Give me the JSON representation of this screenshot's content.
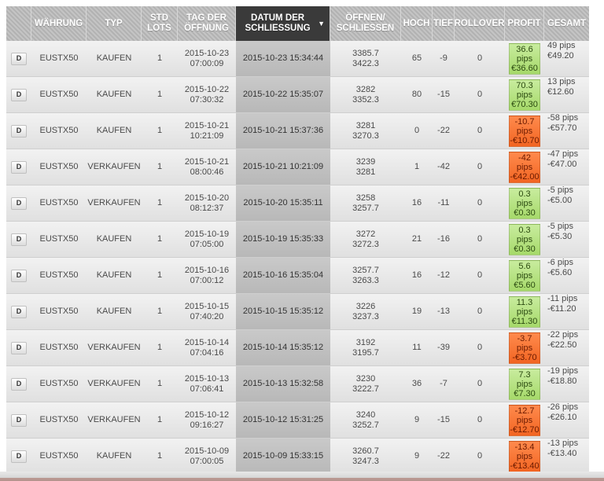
{
  "headers": {
    "d": "",
    "currency": "WÄHRUNG",
    "type": "TYP",
    "lots": "STD LOTS",
    "open_date": "TAG DER ÖFFNUNG",
    "close_date": "DATUM DER SCHLIESSUNG",
    "open_close": "ÖFFNEN/ SCHLIESSEN",
    "high": "HOCH",
    "low": "TIEF",
    "rollover": "ROLLOVER",
    "profit": "PROFIT",
    "total": "GESAMT"
  },
  "sort_arrow": "▼",
  "colors": {
    "win": "#a6d96a",
    "loss": "#f26522",
    "sorted_header": "#3a3a3a"
  },
  "rows": [
    {
      "d": "D",
      "currency": "EUSTX50",
      "type": "KAUFEN",
      "lots": "1",
      "open_date": "2015-10-23",
      "open_time": "07:00:09",
      "close": "2015-10-23 15:34:44",
      "open_px": "3385.7",
      "close_px": "3422.3",
      "high": "65",
      "low": "-9",
      "rollover": "0",
      "profit_pips": "36.6",
      "profit_unit": "pips",
      "profit_eur": "€36.60",
      "result": "win",
      "total_pips": "49 pips",
      "total_eur": "€49.20"
    },
    {
      "d": "D",
      "currency": "EUSTX50",
      "type": "KAUFEN",
      "lots": "1",
      "open_date": "2015-10-22",
      "open_time": "07:30:32",
      "close": "2015-10-22 15:35:07",
      "open_px": "3282",
      "close_px": "3352.3",
      "high": "80",
      "low": "-15",
      "rollover": "0",
      "profit_pips": "70.3",
      "profit_unit": "pips",
      "profit_eur": "€70.30",
      "result": "win",
      "total_pips": "13 pips",
      "total_eur": "€12.60"
    },
    {
      "d": "D",
      "currency": "EUSTX50",
      "type": "KAUFEN",
      "lots": "1",
      "open_date": "2015-10-21",
      "open_time": "10:21:09",
      "close": "2015-10-21 15:37:36",
      "open_px": "3281",
      "close_px": "3270.3",
      "high": "0",
      "low": "-22",
      "rollover": "0",
      "profit_pips": "-10.7",
      "profit_unit": "pips",
      "profit_eur": "-€10.70",
      "result": "loss",
      "total_pips": "-58 pips",
      "total_eur": "-€57.70"
    },
    {
      "d": "D",
      "currency": "EUSTX50",
      "type": "VERKAUFEN",
      "lots": "1",
      "open_date": "2015-10-21",
      "open_time": "08:00:46",
      "close": "2015-10-21 10:21:09",
      "open_px": "3239",
      "close_px": "3281",
      "high": "1",
      "low": "-42",
      "rollover": "0",
      "profit_pips": "-42",
      "profit_unit": "pips",
      "profit_eur": "-€42.00",
      "result": "loss",
      "total_pips": "-47 pips",
      "total_eur": "-€47.00"
    },
    {
      "d": "D",
      "currency": "EUSTX50",
      "type": "VERKAUFEN",
      "lots": "1",
      "open_date": "2015-10-20",
      "open_time": "08:12:37",
      "close": "2015-10-20 15:35:11",
      "open_px": "3258",
      "close_px": "3257.7",
      "high": "16",
      "low": "-11",
      "rollover": "0",
      "profit_pips": "0.3",
      "profit_unit": "pips",
      "profit_eur": "€0.30",
      "result": "win",
      "total_pips": "-5 pips",
      "total_eur": "-€5.00"
    },
    {
      "d": "D",
      "currency": "EUSTX50",
      "type": "KAUFEN",
      "lots": "1",
      "open_date": "2015-10-19",
      "open_time": "07:05:00",
      "close": "2015-10-19 15:35:33",
      "open_px": "3272",
      "close_px": "3272.3",
      "high": "21",
      "low": "-16",
      "rollover": "0",
      "profit_pips": "0.3",
      "profit_unit": "pips",
      "profit_eur": "€0.30",
      "result": "win",
      "total_pips": "-5 pips",
      "total_eur": "-€5.30"
    },
    {
      "d": "D",
      "currency": "EUSTX50",
      "type": "KAUFEN",
      "lots": "1",
      "open_date": "2015-10-16",
      "open_time": "07:00:12",
      "close": "2015-10-16 15:35:04",
      "open_px": "3257.7",
      "close_px": "3263.3",
      "high": "16",
      "low": "-12",
      "rollover": "0",
      "profit_pips": "5.6",
      "profit_unit": "pips",
      "profit_eur": "€5.60",
      "result": "win",
      "total_pips": "-6 pips",
      "total_eur": "-€5.60"
    },
    {
      "d": "D",
      "currency": "EUSTX50",
      "type": "KAUFEN",
      "lots": "1",
      "open_date": "2015-10-15",
      "open_time": "07:40:20",
      "close": "2015-10-15 15:35:12",
      "open_px": "3226",
      "close_px": "3237.3",
      "high": "19",
      "low": "-13",
      "rollover": "0",
      "profit_pips": "11.3",
      "profit_unit": "pips",
      "profit_eur": "€11.30",
      "result": "win",
      "total_pips": "-11 pips",
      "total_eur": "-€11.20"
    },
    {
      "d": "D",
      "currency": "EUSTX50",
      "type": "VERKAUFEN",
      "lots": "1",
      "open_date": "2015-10-14",
      "open_time": "07:04:16",
      "close": "2015-10-14 15:35:12",
      "open_px": "3192",
      "close_px": "3195.7",
      "high": "11",
      "low": "-39",
      "rollover": "0",
      "profit_pips": "-3.7",
      "profit_unit": "pips",
      "profit_eur": "-€3.70",
      "result": "loss",
      "total_pips": "-22 pips",
      "total_eur": "-€22.50"
    },
    {
      "d": "D",
      "currency": "EUSTX50",
      "type": "VERKAUFEN",
      "lots": "1",
      "open_date": "2015-10-13",
      "open_time": "07:06:41",
      "close": "2015-10-13 15:32:58",
      "open_px": "3230",
      "close_px": "3222.7",
      "high": "36",
      "low": "-7",
      "rollover": "0",
      "profit_pips": "7.3",
      "profit_unit": "pips",
      "profit_eur": "€7.30",
      "result": "win",
      "total_pips": "-19 pips",
      "total_eur": "-€18.80"
    },
    {
      "d": "D",
      "currency": "EUSTX50",
      "type": "VERKAUFEN",
      "lots": "1",
      "open_date": "2015-10-12",
      "open_time": "09:16:27",
      "close": "2015-10-12 15:31:25",
      "open_px": "3240",
      "close_px": "3252.7",
      "high": "9",
      "low": "-15",
      "rollover": "0",
      "profit_pips": "-12.7",
      "profit_unit": "pips",
      "profit_eur": "-€12.70",
      "result": "loss",
      "total_pips": "-26 pips",
      "total_eur": "-€26.10"
    },
    {
      "d": "D",
      "currency": "EUSTX50",
      "type": "KAUFEN",
      "lots": "1",
      "open_date": "2015-10-09",
      "open_time": "07:00:05",
      "close": "2015-10-09 15:33:15",
      "open_px": "3260.7",
      "close_px": "3247.3",
      "high": "9",
      "low": "-22",
      "rollover": "0",
      "profit_pips": "-13.4",
      "profit_unit": "pips",
      "profit_eur": "-€13.40",
      "result": "loss",
      "total_pips": "-13 pips",
      "total_eur": "-€13.40"
    }
  ]
}
